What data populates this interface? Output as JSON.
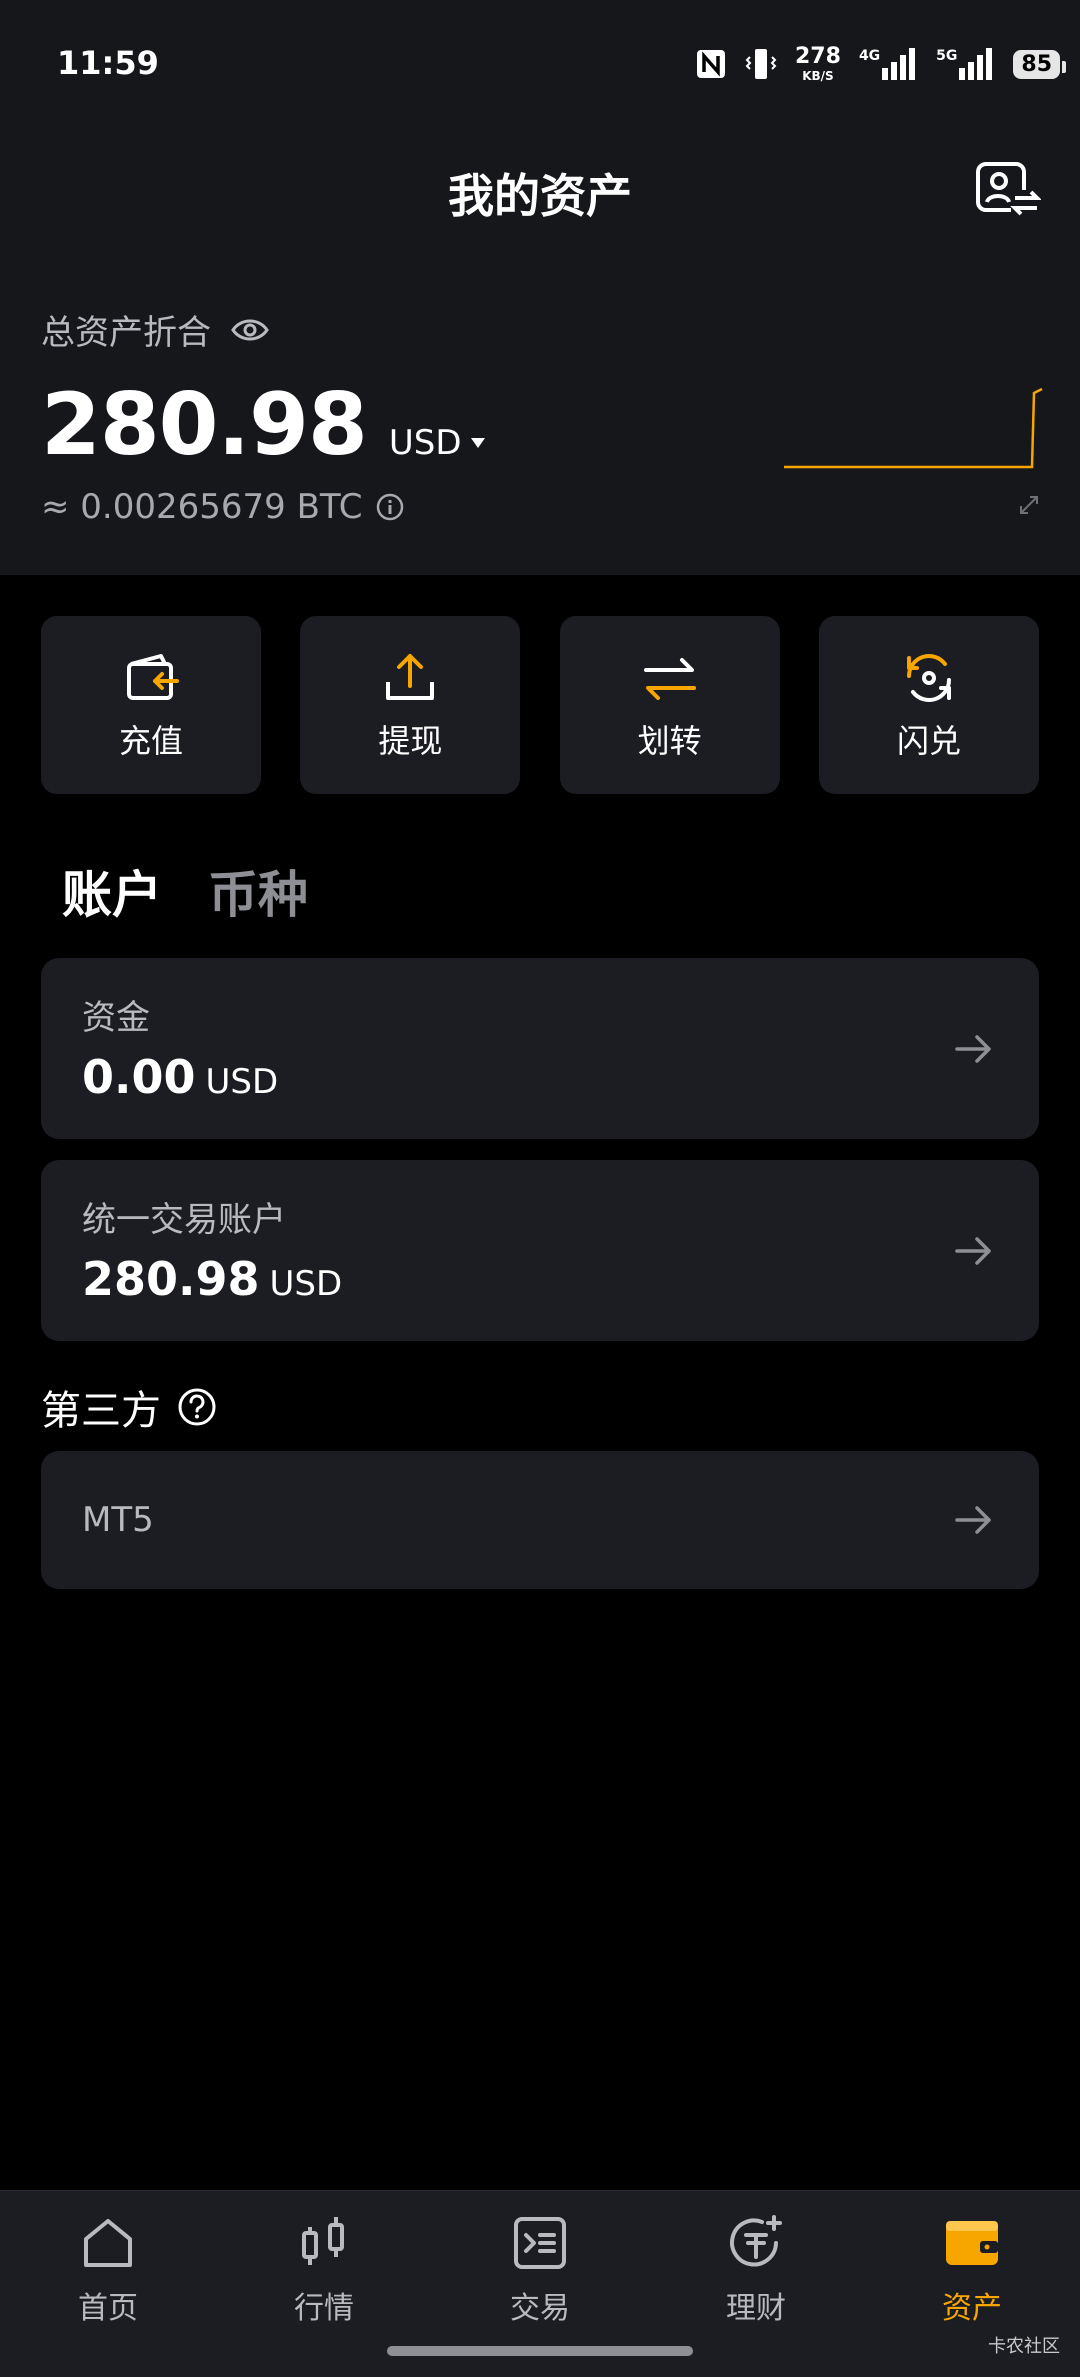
{
  "status_bar": {
    "time": "11:59",
    "speed_value": "278",
    "speed_unit": "KB/S",
    "net_a": "4G",
    "net_b": "5G",
    "battery": "85"
  },
  "header": {
    "title": "我的资产",
    "profile_icon": "profile-swap-icon"
  },
  "summary": {
    "label": "总资产折合",
    "balance": "280.98",
    "currency": "USD",
    "btc_equivalent": "≈ 0.00265679 BTC"
  },
  "actions": [
    {
      "label": "充值",
      "icon": "deposit-icon"
    },
    {
      "label": "提现",
      "icon": "withdraw-icon"
    },
    {
      "label": "划转",
      "icon": "transfer-icon"
    },
    {
      "label": "闪兑",
      "icon": "convert-icon"
    }
  ],
  "tabs": [
    {
      "label": "账户",
      "active": true
    },
    {
      "label": "币种",
      "active": false
    }
  ],
  "accounts": [
    {
      "name": "资金",
      "value": "0.00",
      "currency": "USD"
    },
    {
      "name": "统一交易账户",
      "value": "280.98",
      "currency": "USD"
    }
  ],
  "third_party": {
    "title": "第三方",
    "items": [
      {
        "name": "MT5"
      }
    ]
  },
  "bottom_nav": [
    {
      "label": "首页",
      "icon": "home-icon",
      "active": false
    },
    {
      "label": "行情",
      "icon": "candlestick-icon",
      "active": false
    },
    {
      "label": "交易",
      "icon": "trade-icon",
      "active": false
    },
    {
      "label": "理财",
      "icon": "earn-icon",
      "active": false
    },
    {
      "label": "资产",
      "icon": "wallet-icon",
      "active": true
    }
  ],
  "colors": {
    "accent": "#f7a600",
    "card_bg": "#1c1d22",
    "header_bg": "#16171b",
    "muted_text": "#b8bac0"
  },
  "watermark": "卡农社区"
}
